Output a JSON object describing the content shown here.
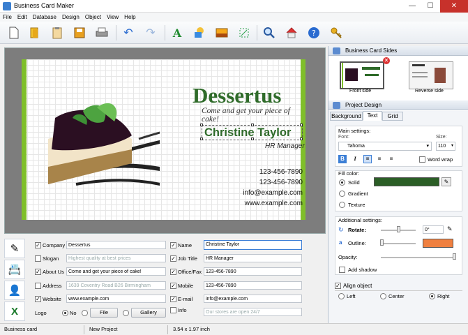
{
  "window": {
    "title": "Business Card Maker",
    "controls": {
      "minimize": "—",
      "maximize": "☐",
      "close": "✕"
    }
  },
  "menu": [
    "File",
    "Edit",
    "Database",
    "Design",
    "Object",
    "View",
    "Help"
  ],
  "toolbar": {
    "icons": [
      "new-icon",
      "open-icon",
      "templates-icon",
      "save-icon",
      "print-icon",
      "undo-icon",
      "redo-icon",
      "add-text-icon",
      "add-shape-icon",
      "add-image-icon",
      "crop-icon",
      "zoom-icon",
      "home-icon",
      "help-icon",
      "key-icon"
    ]
  },
  "card": {
    "company": "Dessertus",
    "slogan": "Come and get your piece of cake!",
    "name": "Christine Taylor",
    "job": "HR Manager",
    "phone": "123-456-7890",
    "fax": "123-456-7890",
    "email": "info@example.com",
    "website": "www.example.com",
    "accent": "#2f6b2a",
    "bar_color": "#7fbf2a"
  },
  "fields": {
    "left": [
      {
        "label": "Company",
        "checked": true,
        "value": "Dessertus",
        "placeholder": false
      },
      {
        "label": "Slogan",
        "checked": false,
        "value": "Highest quality at best prices",
        "placeholder": true
      },
      {
        "label": "About Us",
        "checked": true,
        "value": "Come and get your piece of cake!",
        "placeholder": false
      },
      {
        "label": "Address",
        "checked": false,
        "value": "1639 Coventry Road B26 Birmingham",
        "placeholder": true
      },
      {
        "label": "Website",
        "checked": true,
        "value": "www.example.com",
        "placeholder": false
      }
    ],
    "right": [
      {
        "label": "Name",
        "checked": true,
        "value": "Christine Taylor",
        "placeholder": false
      },
      {
        "label": "Job Title",
        "checked": true,
        "value": "HR Manager",
        "placeholder": false
      },
      {
        "label": "Office/Fax",
        "checked": true,
        "value": "123-456-7890",
        "placeholder": false
      },
      {
        "label": "Mobile",
        "checked": true,
        "value": "123-456-7890",
        "placeholder": false
      },
      {
        "label": "E-mail",
        "checked": true,
        "value": "info@example.com",
        "placeholder": false
      },
      {
        "label": "Info",
        "checked": false,
        "value": "Our stores are open 24/7",
        "placeholder": true
      }
    ],
    "logo": {
      "label": "Logo",
      "no": "No",
      "file": "File",
      "gallery": "Gallery"
    }
  },
  "status": {
    "left": "Business card",
    "mid": "New Project",
    "size": "3.54 x 1.97 inch"
  },
  "panel": {
    "sides_title": "Business Card Sides",
    "front": "Front side",
    "reverse": "Reverse side",
    "design_title": "Project Design",
    "tabs": [
      "Background",
      "Text",
      "Grid"
    ],
    "main_settings": "Main settings:",
    "font_label": "Font:",
    "font_value": "Tahoma",
    "size_label": "Size:",
    "size_value": "110",
    "bold": "B",
    "italic": "I",
    "word_wrap": "Word wrap",
    "fill_color": "Fill color:",
    "solid": "Solid",
    "gradient": "Gradient",
    "texture": "Texture",
    "solid_color": "#2b5e26",
    "additional": "Additional settings:",
    "rotate": "Rotate:",
    "rotate_value": "0°",
    "outline": "Outline:",
    "outline_color": "#f08040",
    "opacity": "Opacity:",
    "add_shadow": "Add shadow",
    "align_title": "Align object",
    "left": "Left",
    "center": "Center",
    "right": "Right"
  }
}
